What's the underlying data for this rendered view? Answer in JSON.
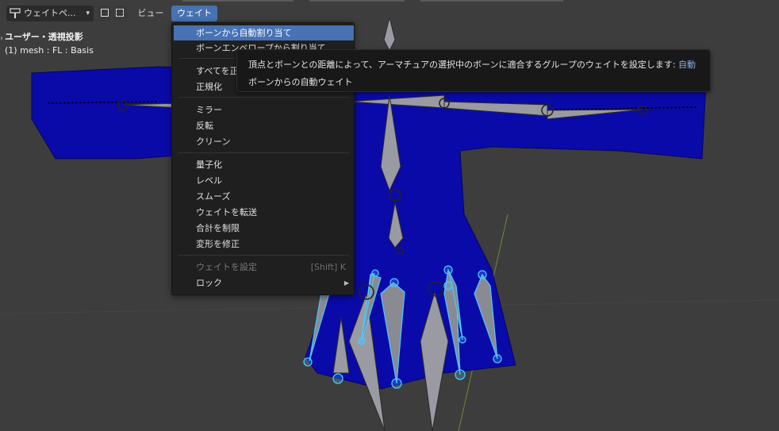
{
  "header": {
    "mode_label": "ウェイトペ...",
    "menu_view": "ビュー",
    "menu_weight": "ウェイト"
  },
  "overlay": {
    "view_title": "ユーザー・透視投影",
    "object_info": "(1) mesh : FL : Basis"
  },
  "weight_menu": {
    "items": [
      {
        "label": "ボーンから自動割り当て"
      },
      {
        "label": "ボーンエンベロープから割り当て"
      },
      {
        "label": "すべてを正規化"
      },
      {
        "label": "正規化"
      },
      {
        "label": "ミラー"
      },
      {
        "label": "反転"
      },
      {
        "label": "クリーン"
      },
      {
        "label": "量子化"
      },
      {
        "label": "レベル"
      },
      {
        "label": "スムーズ"
      },
      {
        "label": "ウェイトを転送"
      },
      {
        "label": "合計を制限"
      },
      {
        "label": "変形を修正"
      },
      {
        "label": "ウェイトを設定",
        "shortcut": "[Shift] K"
      },
      {
        "label": "ロック"
      }
    ]
  },
  "tooltip": {
    "description": "頂点とボーンとの距離によって、アーマチュアの選択中のボーンに適合するグループのウェイトを設定します:",
    "description_highlight": "自動",
    "python_name": "ボーンからの自動ウェイト"
  },
  "colors": {
    "viewport_bg": "#3d3d3d",
    "mesh_blue": "#0a0aa8",
    "menu_bg": "#1f1f1f",
    "accent": "#4772b3",
    "bone_gray": "#9a9aa2",
    "bone_selected": "#4cc8ff"
  }
}
